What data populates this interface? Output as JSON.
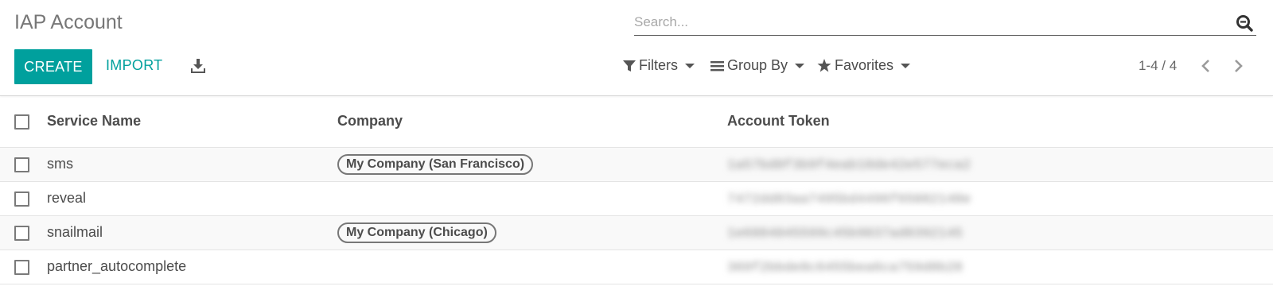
{
  "title": "IAP Account",
  "search": {
    "placeholder": "Search..."
  },
  "toolbar": {
    "create_label": "CREATE",
    "import_label": "IMPORT"
  },
  "filters": {
    "filters_label": "Filters",
    "group_by_label": "Group By",
    "favorites_label": "Favorites"
  },
  "pager": {
    "value": "1-4 / 4"
  },
  "colors": {
    "accent": "#00A09D",
    "text": "#4c4c4c"
  },
  "table": {
    "columns": [
      "Service Name",
      "Company",
      "Account Token"
    ],
    "rows": [
      {
        "service": "sms",
        "company": "My Company (San Francisco)",
        "token": "1a57bd0f3b9f4eab18de42e577eca2"
      },
      {
        "service": "reveal",
        "company": "",
        "token": "7472dd83aa7495bd4496f65082148e"
      },
      {
        "service": "snailmail",
        "company": "My Company (Chicago)",
        "token": "1e6884045599c45b9037ad0392145"
      },
      {
        "service": "partner_autocomplete",
        "company": "",
        "token": "369f2bbde8c6455bea6ca759d8b28"
      }
    ]
  }
}
